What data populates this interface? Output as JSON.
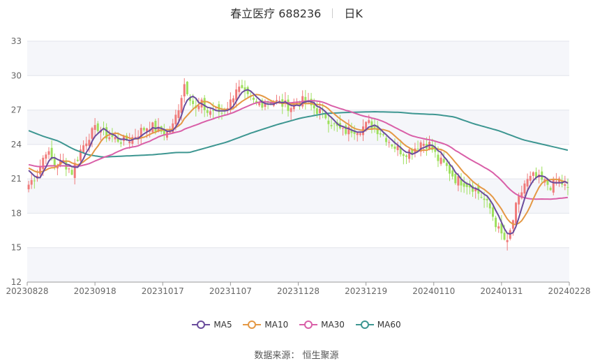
{
  "header": {
    "stock": "春立医疗 688236",
    "period": "日K"
  },
  "legend": [
    {
      "label": "MA5",
      "color": "#6a4c9c"
    },
    {
      "label": "MA10",
      "color": "#e49844"
    },
    {
      "label": "MA30",
      "color": "#d95fa8"
    },
    {
      "label": "MA60",
      "color": "#3d9691"
    }
  ],
  "source": "数据来源： 恒生聚源",
  "colors": {
    "up": "#f07a7a",
    "down": "#9de05c"
  },
  "chart_data": {
    "type": "candlestick",
    "ylim": [
      12,
      33
    ],
    "yticks": [
      12,
      15,
      18,
      21,
      24,
      27,
      30,
      33
    ],
    "xticks": [
      "20230828",
      "20230918",
      "20231017",
      "20231107",
      "20231128",
      "20231219",
      "20240110",
      "20240131",
      "20240228"
    ],
    "grid": true,
    "legend_position": "bottom",
    "anchors": [
      [
        0,
        20.5
      ],
      [
        3,
        21.5
      ],
      [
        6,
        23.5
      ],
      [
        9,
        22.2
      ],
      [
        12,
        22.5
      ],
      [
        15,
        21.6
      ],
      [
        18,
        23.5
      ],
      [
        21,
        24.8
      ],
      [
        24,
        25.5
      ],
      [
        27,
        24.8
      ],
      [
        30,
        24.5
      ],
      [
        33,
        24.3
      ],
      [
        36,
        24.6
      ],
      [
        39,
        25.2
      ],
      [
        42,
        25.7
      ],
      [
        45,
        25.2
      ],
      [
        48,
        25.0
      ],
      [
        50,
        25.6
      ],
      [
        52,
        27.3
      ],
      [
        54,
        29.3
      ],
      [
        56,
        28.2
      ],
      [
        58,
        27.0
      ],
      [
        60,
        27.5
      ],
      [
        62,
        26.8
      ],
      [
        64,
        27.0
      ],
      [
        67,
        26.8
      ],
      [
        70,
        27.7
      ],
      [
        72,
        29.0
      ],
      [
        74,
        28.6
      ],
      [
        76,
        28.0
      ],
      [
        79,
        27.5
      ],
      [
        82,
        27.7
      ],
      [
        85,
        27.8
      ],
      [
        88,
        27.5
      ],
      [
        91,
        27.3
      ],
      [
        94,
        27.9
      ],
      [
        97,
        27.5
      ],
      [
        100,
        27.0
      ],
      [
        103,
        26.5
      ],
      [
        106,
        25.6
      ],
      [
        109,
        25.1
      ],
      [
        112,
        25.3
      ],
      [
        115,
        25.4
      ],
      [
        118,
        25.8
      ],
      [
        121,
        25.3
      ],
      [
        124,
        24.6
      ],
      [
        127,
        23.8
      ],
      [
        130,
        23.3
      ],
      [
        133,
        23.5
      ],
      [
        136,
        24.2
      ],
      [
        139,
        24.0
      ],
      [
        142,
        22.7
      ],
      [
        145,
        22.0
      ],
      [
        148,
        21.0
      ],
      [
        151,
        20.7
      ],
      [
        154,
        20.3
      ],
      [
        157,
        19.5
      ],
      [
        160,
        18.4
      ],
      [
        163,
        16.5
      ],
      [
        166,
        15.3
      ],
      [
        169,
        18.5
      ],
      [
        172,
        20.6
      ],
      [
        175,
        21.2
      ],
      [
        178,
        20.8
      ],
      [
        181,
        20.4
      ],
      [
        184,
        20.9
      ],
      [
        187,
        20.0
      ]
    ],
    "ma60_anchors": [
      [
        0,
        25.2
      ],
      [
        6,
        24.7
      ],
      [
        12,
        24.3
      ],
      [
        18,
        23.6
      ],
      [
        24,
        23.1
      ],
      [
        30,
        22.9
      ],
      [
        40,
        23.0
      ],
      [
        50,
        23.1
      ],
      [
        60,
        23.3
      ],
      [
        65,
        23.3
      ],
      [
        70,
        23.6
      ],
      [
        80,
        24.2
      ],
      [
        90,
        25.0
      ],
      [
        100,
        25.7
      ],
      [
        110,
        26.3
      ],
      [
        120,
        26.7
      ],
      [
        130,
        26.8
      ],
      [
        140,
        26.85
      ],
      [
        150,
        26.8
      ],
      [
        155,
        26.7
      ],
      [
        165,
        26.6
      ],
      [
        172,
        26.4
      ],
      [
        180,
        25.8
      ],
      [
        190,
        25.2
      ],
      [
        200,
        24.4
      ],
      [
        210,
        23.9
      ],
      [
        218,
        23.5
      ]
    ]
  }
}
